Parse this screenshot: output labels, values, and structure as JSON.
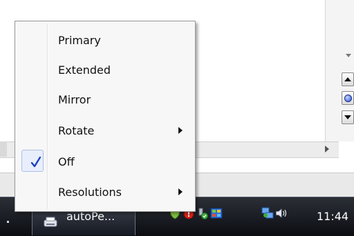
{
  "context_menu": {
    "items": [
      {
        "label": "Primary",
        "checked": false,
        "has_submenu": false
      },
      {
        "label": "Extended",
        "checked": false,
        "has_submenu": false
      },
      {
        "label": "Mirror",
        "checked": false,
        "has_submenu": false
      },
      {
        "label": "Rotate",
        "checked": false,
        "has_submenu": true
      },
      {
        "label": "Off",
        "checked": true,
        "has_submenu": false
      },
      {
        "label": "Resolutions",
        "checked": false,
        "has_submenu": true
      }
    ]
  },
  "taskbar": {
    "task_label": "autoPe...",
    "clock": "11:44",
    "tray_icons": [
      "shield-icon",
      "antivirus-icon",
      "usb-safely-remove-icon",
      "display-icon",
      "network-icon",
      "volume-icon"
    ]
  },
  "colors": {
    "menu_background": "#f7f7f7",
    "check_highlight": "#e8eefb",
    "check_mark": "#1b3fbf",
    "taskbar": "#0b0d12"
  }
}
